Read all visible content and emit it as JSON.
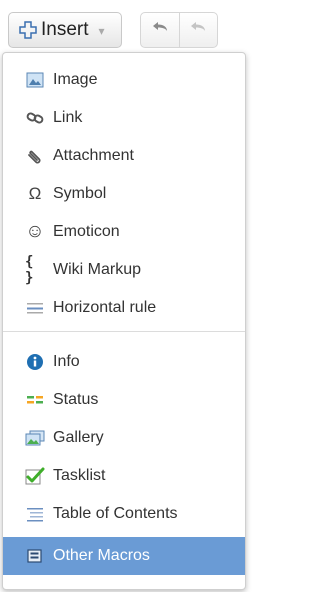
{
  "toolbar": {
    "insert_label": "Insert",
    "caret": "▾"
  },
  "menu": {
    "items": [
      {
        "label": "Image",
        "icon": "image-icon"
      },
      {
        "label": "Link",
        "icon": "link-icon"
      },
      {
        "label": "Attachment",
        "icon": "paperclip-icon"
      },
      {
        "label": "Symbol",
        "icon": "omega-icon",
        "glyph": "Ω"
      },
      {
        "label": "Emoticon",
        "icon": "smiley-icon",
        "glyph": "☺"
      },
      {
        "label": "Wiki Markup",
        "icon": "braces-icon",
        "glyph": "{ }"
      },
      {
        "label": "Horizontal rule",
        "icon": "horizontal-rule-icon"
      },
      {
        "label": "Info",
        "icon": "info-icon"
      },
      {
        "label": "Status",
        "icon": "status-icon"
      },
      {
        "label": "Gallery",
        "icon": "gallery-icon"
      },
      {
        "label": "Tasklist",
        "icon": "checkbox-icon"
      },
      {
        "label": "Table of Contents",
        "icon": "toc-icon"
      },
      {
        "label": "Other Macros",
        "icon": "macros-icon",
        "selected": true
      }
    ]
  },
  "colors": {
    "selected_bg": "#6a9bd5",
    "info_blue": "#1f6fb2",
    "status_green": "#4caf50",
    "status_orange": "#f6a623"
  }
}
